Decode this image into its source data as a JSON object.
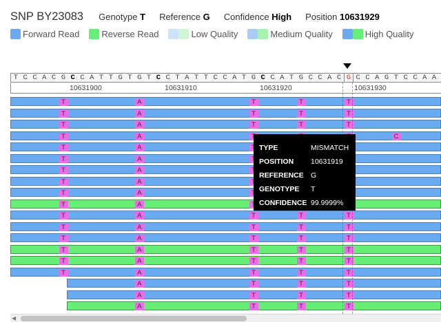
{
  "header": {
    "title": "SNP BY23083",
    "genotype_label": "Genotype",
    "genotype_value": "T",
    "reference_label": "Reference",
    "reference_value": "G",
    "confidence_label": "Confidence",
    "confidence_value": "High",
    "position_label": "Position",
    "position_value": "10631929"
  },
  "legend": {
    "forward_read": "Forward Read",
    "reverse_read": "Reverse Read",
    "low_quality": "Low Quality",
    "medium_quality": "Medium Quality",
    "high_quality": "High Quality"
  },
  "colors": {
    "forward_read": "#6aaaf0",
    "reverse_read": "#66ee77",
    "low_forward": "#cfe2fb",
    "low_reverse": "#cdf7d2",
    "medium_forward": "#a7cdf7",
    "medium_reverse": "#a6f2af",
    "high_forward": "#6aaaf0",
    "high_reverse": "#66ee77",
    "mismatch": "#ee6ae8",
    "snp_reference_base": "#e0301e"
  },
  "reference_sequence": [
    "T",
    "C",
    "C",
    "A",
    "C",
    "G",
    "C",
    "C",
    "A",
    "T",
    "T",
    "G",
    "T",
    "G",
    "T",
    "C",
    "C",
    "T",
    "A",
    "T",
    "T",
    "C",
    "C",
    "A",
    "T",
    "G",
    "C",
    "C",
    "A",
    "T",
    "G",
    "C",
    "C",
    "A",
    "C",
    "G",
    "C",
    "C",
    "A",
    "G",
    "T",
    "C",
    "C",
    "A",
    "A",
    "T"
  ],
  "ruler": {
    "labels": [
      "10631900",
      "10631910",
      "10631920",
      "10631930"
    ]
  },
  "reads": [
    {
      "strand": "forward",
      "mismatches": [
        {
          "col": 5,
          "base": "T"
        },
        {
          "col": 13,
          "base": "A"
        },
        {
          "col": 25,
          "base": "T"
        },
        {
          "col": 30,
          "base": "T"
        },
        {
          "col": 35,
          "base": "T"
        }
      ]
    },
    {
      "strand": "forward",
      "mismatches": [
        {
          "col": 5,
          "base": "T"
        },
        {
          "col": 13,
          "base": "A"
        },
        {
          "col": 25,
          "base": "T"
        },
        {
          "col": 30,
          "base": "T"
        },
        {
          "col": 35,
          "base": "T"
        }
      ]
    },
    {
      "strand": "forward",
      "mismatches": [
        {
          "col": 5,
          "base": "T"
        },
        {
          "col": 13,
          "base": "A"
        },
        {
          "col": 25,
          "base": "T"
        },
        {
          "col": 30,
          "base": "T"
        },
        {
          "col": 35,
          "base": "T"
        }
      ]
    },
    {
      "strand": "forward",
      "mismatches": [
        {
          "col": 5,
          "base": "T"
        },
        {
          "col": 13,
          "base": "A"
        },
        {
          "col": 25,
          "base": "T"
        },
        {
          "col": 30,
          "base": "T"
        },
        {
          "col": 35,
          "base": "T"
        },
        {
          "col": 40,
          "base": "C"
        }
      ]
    },
    {
      "strand": "forward",
      "mismatches": [
        {
          "col": 5,
          "base": "T"
        },
        {
          "col": 13,
          "base": "A"
        },
        {
          "col": 25,
          "base": "T"
        },
        {
          "col": 30,
          "base": "T"
        },
        {
          "col": 35,
          "base": "T"
        }
      ]
    },
    {
      "strand": "forward",
      "mismatches": [
        {
          "col": 5,
          "base": "T"
        },
        {
          "col": 13,
          "base": "A"
        },
        {
          "col": 25,
          "base": "T"
        },
        {
          "col": 30,
          "base": "T"
        },
        {
          "col": 35,
          "base": "T"
        }
      ]
    },
    {
      "strand": "forward",
      "mismatches": [
        {
          "col": 5,
          "base": "T"
        },
        {
          "col": 13,
          "base": "A"
        },
        {
          "col": 25,
          "base": "T"
        },
        {
          "col": 30,
          "base": "T"
        },
        {
          "col": 35,
          "base": "T"
        }
      ]
    },
    {
      "strand": "forward",
      "mismatches": [
        {
          "col": 5,
          "base": "T"
        },
        {
          "col": 13,
          "base": "A"
        },
        {
          "col": 25,
          "base": "T"
        },
        {
          "col": 30,
          "base": "T"
        },
        {
          "col": 35,
          "base": "T"
        }
      ]
    },
    {
      "strand": "forward",
      "mismatches": [
        {
          "col": 5,
          "base": "T"
        },
        {
          "col": 13,
          "base": "A"
        },
        {
          "col": 25,
          "base": "T"
        },
        {
          "col": 30,
          "base": "T"
        },
        {
          "col": 35,
          "base": "T"
        }
      ]
    },
    {
      "strand": "reverse",
      "mismatches": [
        {
          "col": 5,
          "base": "T"
        },
        {
          "col": 13,
          "base": "A"
        },
        {
          "col": 25,
          "base": "T"
        },
        {
          "col": 30,
          "base": "T"
        },
        {
          "col": 35,
          "base": "T"
        }
      ]
    },
    {
      "strand": "forward",
      "mismatches": [
        {
          "col": 5,
          "base": "T"
        },
        {
          "col": 13,
          "base": "A"
        },
        {
          "col": 25,
          "base": "T"
        },
        {
          "col": 30,
          "base": "T"
        },
        {
          "col": 35,
          "base": "T"
        }
      ]
    },
    {
      "strand": "forward",
      "mismatches": [
        {
          "col": 5,
          "base": "T"
        },
        {
          "col": 13,
          "base": "A"
        },
        {
          "col": 25,
          "base": "T"
        },
        {
          "col": 30,
          "base": "T"
        },
        {
          "col": 35,
          "base": "T"
        }
      ]
    },
    {
      "strand": "forward",
      "mismatches": [
        {
          "col": 5,
          "base": "T"
        },
        {
          "col": 13,
          "base": "A"
        },
        {
          "col": 25,
          "base": "T"
        },
        {
          "col": 30,
          "base": "T"
        },
        {
          "col": 35,
          "base": "T"
        }
      ]
    },
    {
      "strand": "reverse",
      "mismatches": [
        {
          "col": 5,
          "base": "T"
        },
        {
          "col": 13,
          "base": "A"
        },
        {
          "col": 25,
          "base": "T"
        },
        {
          "col": 30,
          "base": "T"
        },
        {
          "col": 35,
          "base": "T"
        }
      ]
    },
    {
      "strand": "reverse",
      "mismatches": [
        {
          "col": 5,
          "base": "T"
        },
        {
          "col": 13,
          "base": "A"
        },
        {
          "col": 25,
          "base": "T"
        },
        {
          "col": 30,
          "base": "T"
        },
        {
          "col": 35,
          "base": "T"
        }
      ]
    },
    {
      "strand": "forward",
      "mismatches": [
        {
          "col": 5,
          "base": "T"
        },
        {
          "col": 13,
          "base": "A"
        },
        {
          "col": 25,
          "base": "T"
        },
        {
          "col": 30,
          "base": "T"
        },
        {
          "col": 35,
          "base": "T"
        }
      ]
    },
    {
      "strand": "forward",
      "mismatches": [
        {
          "col": 13,
          "base": "A"
        },
        {
          "col": 25,
          "base": "T"
        },
        {
          "col": 30,
          "base": "T"
        },
        {
          "col": 35,
          "base": "T"
        }
      ]
    },
    {
      "strand": "forward",
      "mismatches": [
        {
          "col": 13,
          "base": "A"
        },
        {
          "col": 25,
          "base": "T"
        },
        {
          "col": 30,
          "base": "T"
        },
        {
          "col": 35,
          "base": "T"
        }
      ]
    },
    {
      "strand": "reverse",
      "mismatches": [
        {
          "col": 13,
          "base": "A"
        },
        {
          "col": 25,
          "base": "T"
        },
        {
          "col": 30,
          "base": "T"
        },
        {
          "col": 35,
          "base": "T"
        }
      ]
    }
  ],
  "tooltip": {
    "type_label": "TYPE",
    "type_value": "MISMATCH",
    "position_label": "POSITION",
    "position_value": "10631919",
    "reference_label": "REFERENCE",
    "reference_value": "G",
    "genotype_label": "GENOTYPE",
    "genotype_value": "T",
    "confidence_label": "CONFIDENCE",
    "confidence_value": "99.9999%"
  }
}
